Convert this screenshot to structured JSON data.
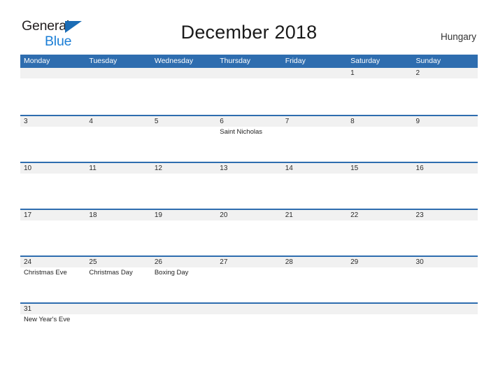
{
  "brand": {
    "line1": "General",
    "line2": "Blue",
    "triangle_icon": "triangle-icon",
    "color_dark": "#231f20",
    "color_blue": "#1b7ed6"
  },
  "header": {
    "title": "December 2018",
    "region": "Hungary"
  },
  "theme": {
    "header_blue": "#2e6daf",
    "row_gray": "#f1f1f1",
    "text_dark": "#1a1a1a"
  },
  "calendar": {
    "weekdays": [
      "Monday",
      "Tuesday",
      "Wednesday",
      "Thursday",
      "Friday",
      "Saturday",
      "Sunday"
    ],
    "weeks": [
      {
        "days": [
          {
            "number": "",
            "event": ""
          },
          {
            "number": "",
            "event": ""
          },
          {
            "number": "",
            "event": ""
          },
          {
            "number": "",
            "event": ""
          },
          {
            "number": "",
            "event": ""
          },
          {
            "number": "1",
            "event": ""
          },
          {
            "number": "2",
            "event": ""
          }
        ]
      },
      {
        "days": [
          {
            "number": "3",
            "event": ""
          },
          {
            "number": "4",
            "event": ""
          },
          {
            "number": "5",
            "event": ""
          },
          {
            "number": "6",
            "event": "Saint Nicholas"
          },
          {
            "number": "7",
            "event": ""
          },
          {
            "number": "8",
            "event": ""
          },
          {
            "number": "9",
            "event": ""
          }
        ]
      },
      {
        "days": [
          {
            "number": "10",
            "event": ""
          },
          {
            "number": "11",
            "event": ""
          },
          {
            "number": "12",
            "event": ""
          },
          {
            "number": "13",
            "event": ""
          },
          {
            "number": "14",
            "event": ""
          },
          {
            "number": "15",
            "event": ""
          },
          {
            "number": "16",
            "event": ""
          }
        ]
      },
      {
        "days": [
          {
            "number": "17",
            "event": ""
          },
          {
            "number": "18",
            "event": ""
          },
          {
            "number": "19",
            "event": ""
          },
          {
            "number": "20",
            "event": ""
          },
          {
            "number": "21",
            "event": ""
          },
          {
            "number": "22",
            "event": ""
          },
          {
            "number": "23",
            "event": ""
          }
        ]
      },
      {
        "days": [
          {
            "number": "24",
            "event": "Christmas Eve"
          },
          {
            "number": "25",
            "event": "Christmas Day"
          },
          {
            "number": "26",
            "event": "Boxing Day"
          },
          {
            "number": "27",
            "event": ""
          },
          {
            "number": "28",
            "event": ""
          },
          {
            "number": "29",
            "event": ""
          },
          {
            "number": "30",
            "event": ""
          }
        ]
      },
      {
        "days": [
          {
            "number": "31",
            "event": "New Year's Eve"
          },
          {
            "number": "",
            "event": ""
          },
          {
            "number": "",
            "event": ""
          },
          {
            "number": "",
            "event": ""
          },
          {
            "number": "",
            "event": ""
          },
          {
            "number": "",
            "event": ""
          },
          {
            "number": "",
            "event": ""
          }
        ]
      }
    ]
  }
}
